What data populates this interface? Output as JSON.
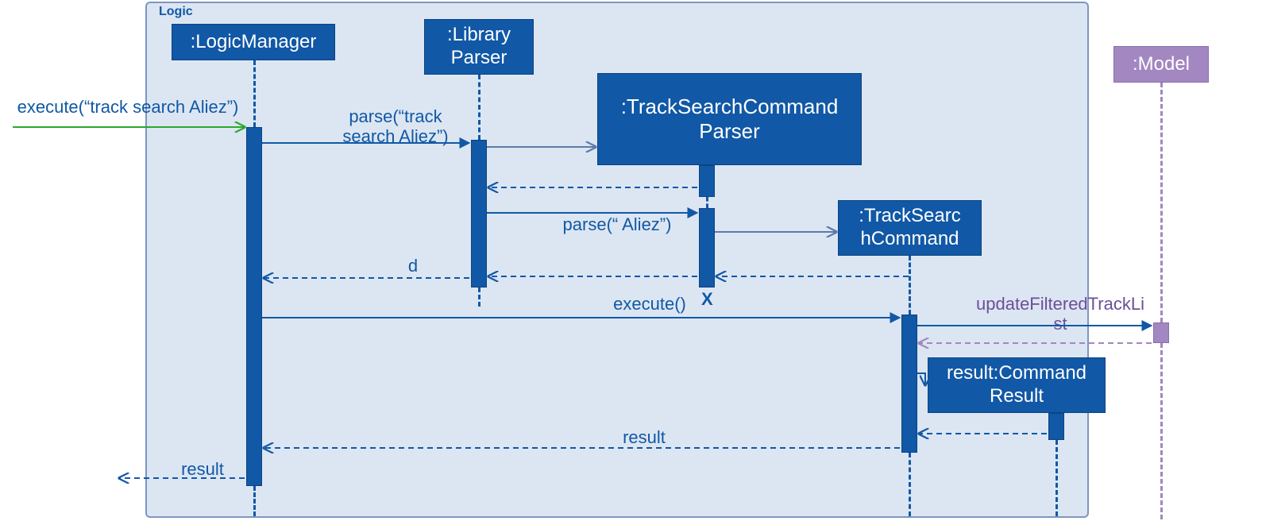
{
  "frame": {
    "label": "Logic"
  },
  "lifelines": {
    "logic_manager": ":LogicManager",
    "library_parser": ":Library\nParser",
    "tscp": ":TrackSearchCommand\nParser",
    "tsc": ":TrackSearc\nhCommand",
    "model": ":Model",
    "cmd_result": "result:Command\nResult"
  },
  "messages": {
    "execute_in": "execute(“track search Aliez”)",
    "parse1": "parse(“track search Aliez”)",
    "parse2": "parse(“ Aliez”)",
    "ret_d": "d",
    "execute_cmd": "execute()",
    "update_list": "updateFilteredTrackLi\nst",
    "ret_result": "result",
    "ret_result_out": "result"
  },
  "destroy_mark": "X"
}
